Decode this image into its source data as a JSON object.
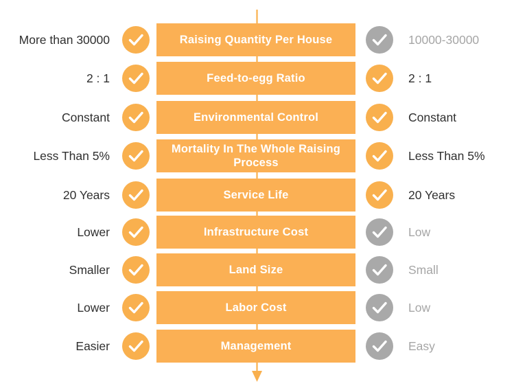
{
  "theme": {
    "orange": "#f9b04e",
    "bar_orange": "#fbb054",
    "gray": "#a9a9a9",
    "dark_text": "#303030",
    "muted_text": "#a6a6a6",
    "background": "#ffffff"
  },
  "arrow": {
    "name": "downward-flow-arrow",
    "color": "#f9b04e"
  },
  "icons": {
    "check": "check-icon"
  },
  "rows": [
    {
      "feature": "Raising Quantity Per House",
      "left_value": "More than 30000",
      "left_check": "orange",
      "left_muted": false,
      "right_value": "10000-30000",
      "right_check": "gray",
      "right_muted": true
    },
    {
      "feature": "Feed-to-egg Ratio",
      "left_value": "2 : 1",
      "left_check": "orange",
      "left_muted": false,
      "right_value": "2 : 1",
      "right_check": "orange",
      "right_muted": false
    },
    {
      "feature": "Environmental Control",
      "left_value": "Constant",
      "left_check": "orange",
      "left_muted": false,
      "right_value": "Constant",
      "right_check": "orange",
      "right_muted": false
    },
    {
      "feature": "Mortality In The Whole Raising Process",
      "left_value": "Less Than 5%",
      "left_check": "orange",
      "left_muted": false,
      "right_value": "Less Than 5%",
      "right_check": "orange",
      "right_muted": false
    },
    {
      "feature": "Service Life",
      "left_value": "20 Years",
      "left_check": "orange",
      "left_muted": false,
      "right_value": "20 Years",
      "right_check": "orange",
      "right_muted": false
    },
    {
      "feature": "Infrastructure Cost",
      "left_value": "Lower",
      "left_check": "orange",
      "left_muted": false,
      "right_value": "Low",
      "right_check": "gray",
      "right_muted": true
    },
    {
      "feature": "Land Size",
      "left_value": "Smaller",
      "left_check": "orange",
      "left_muted": false,
      "right_value": "Small",
      "right_check": "gray",
      "right_muted": true
    },
    {
      "feature": "Labor Cost",
      "left_value": "Lower",
      "left_check": "orange",
      "left_muted": false,
      "right_value": "Low",
      "right_check": "gray",
      "right_muted": true
    },
    {
      "feature": "Management",
      "left_value": "Easier",
      "left_check": "orange",
      "left_muted": false,
      "right_value": "Easy",
      "right_check": "gray",
      "right_muted": true
    }
  ]
}
